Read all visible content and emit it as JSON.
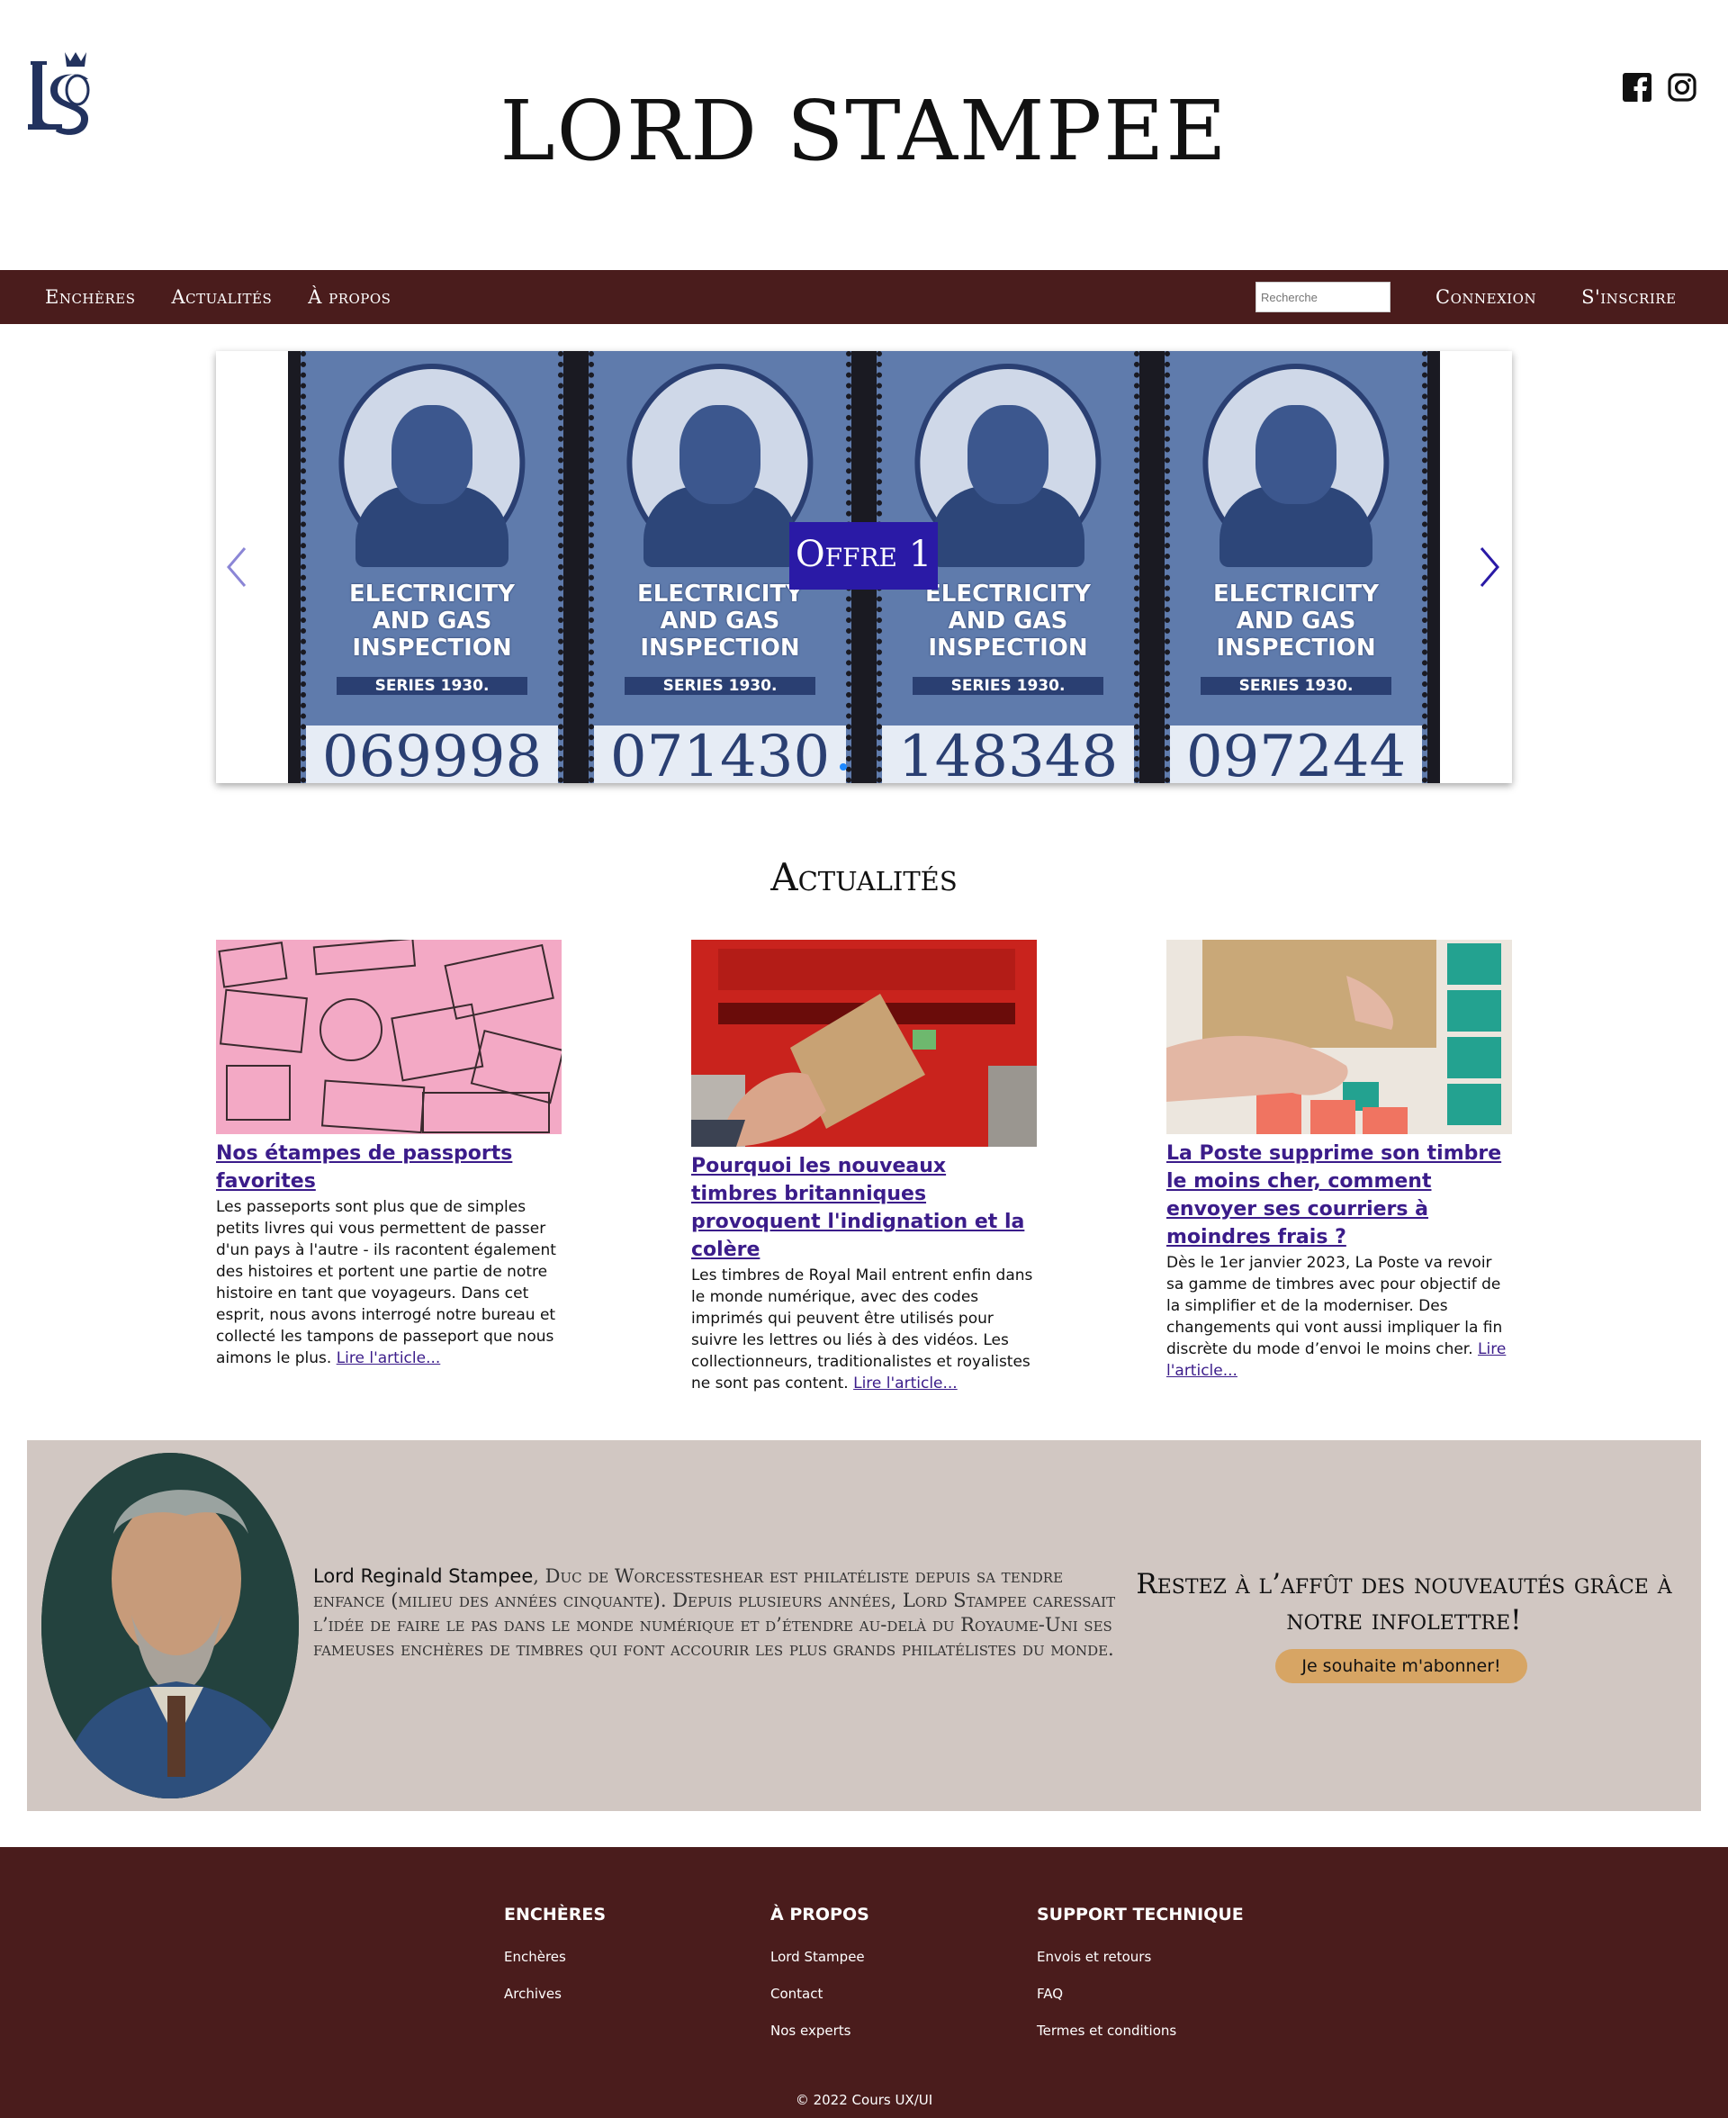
{
  "header": {
    "site_title": "LORD STAMPEE",
    "logo_icon": "ls-crown-lion-logo",
    "socials": [
      {
        "icon": "facebook-icon"
      },
      {
        "icon": "instagram-icon"
      }
    ]
  },
  "nav": {
    "left": [
      "Enchères",
      "Actualités",
      "À propos"
    ],
    "search_placeholder": "Recherche",
    "right": [
      "Connexion",
      "S'inscrire"
    ]
  },
  "carousel": {
    "offer_label": "Offre 1",
    "stamp_text_lines": [
      "ELECTRICITY",
      "AND GAS",
      "INSPECTION"
    ],
    "stamp_series": "SERIES 1930.",
    "stamp_numbers": [
      "069998",
      "071430",
      "148348",
      "097244"
    ],
    "prev_icon": "chevron-left-icon",
    "next_icon": "chevron-right-icon"
  },
  "news": {
    "title": "Actualités",
    "articles": [
      {
        "headline": "Nos étampes de passports favorites",
        "body": "Les passeports sont plus que de simples petits livres qui vous permettent de passer d'un pays à l'autre - ils racontent également des histoires et portent une partie de notre histoire en tant que voyageurs. Dans cet esprit, nous avons interrogé notre bureau et collecté les tampons de passeport que nous aimons le plus.",
        "read_more": "Lire l'article..."
      },
      {
        "headline": "Pourquoi les nouveaux timbres britanniques provoquent l'indignation et la colère",
        "body": "Les timbres de Royal Mail entrent enfin dans le monde numérique, avec des codes imprimés qui peuvent être utilisés pour suivre les lettres ou liés à des vidéos. Les collectionneurs, traditionalistes et royalistes ne sont pas content.",
        "read_more": "Lire l'article..."
      },
      {
        "headline": "La Poste supprime son timbre le moins cher, comment envoyer ses courriers à moindres frais ?",
        "body": "Dès le 1er janvier 2023, La Poste va revoir sa gamme de timbres avec pour objectif de la simplifier et de la moderniser. Des changements qui vont aussi impliquer la fin discrète du mode d’envoi le moins cher.",
        "read_more": "Lire l'article..."
      }
    ]
  },
  "band": {
    "bio_name": "Lord Reginald Stampee",
    "bio_text": ", Duc de Worcessteshear est philatéliste depuis sa tendre enfance (milieu des années cinquante). Depuis plusieurs années, Lord Stampee caressait l’idée de faire le pas dans le monde numérique et d’étendre au-delà du Royaume-Uni ses fameuses enchères de timbres qui font accourir les plus grands philatélistes du monde.",
    "newsletter_text": "Restez à l’affût des nouveautés grâce à notre infolettre!",
    "subscribe_label": "Je souhaite m'abonner!"
  },
  "footer": {
    "columns": [
      {
        "title": "ENCHÈRES",
        "links": [
          "Enchères",
          "Archives"
        ]
      },
      {
        "title": "À PROPOS",
        "links": [
          "Lord Stampee",
          "Contact",
          "Nos experts"
        ]
      },
      {
        "title": "SUPPORT TECHNIQUE",
        "links": [
          "Envois et retours",
          "FAQ",
          "Termes et conditions"
        ]
      }
    ],
    "copyright": "© 2022 Cours UX/UI"
  },
  "colors": {
    "nav_bg": "#4a1c1c",
    "offer_bg": "#2a1aa6",
    "link": "#3b1c8a",
    "band_bg": "#d1c7c2",
    "subscribe_bg": "#d7a564",
    "logo": "#22325e"
  }
}
